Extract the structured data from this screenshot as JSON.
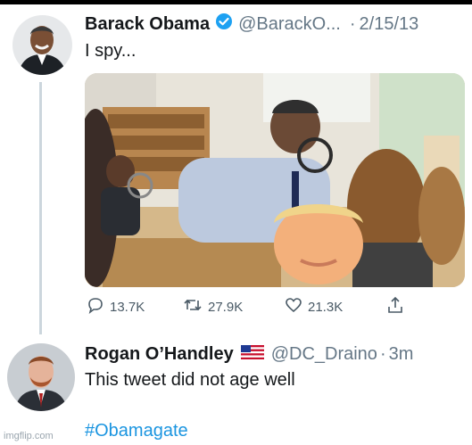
{
  "tweet1": {
    "author_name": "Barack Obama",
    "handle": "@BarackO...",
    "separator": "·",
    "date": "2/15/13",
    "text": "I spy...",
    "actions": {
      "replies": "13.7K",
      "retweets": "27.9K",
      "likes": "21.3K"
    }
  },
  "tweet2": {
    "author_name": "Rogan O’Handley",
    "flag_icon": "us-flag-icon",
    "handle": "@DC_Draino",
    "separator": "·",
    "time": "3m",
    "text": "This tweet did not age well",
    "hashtag": "#Obamagate"
  },
  "watermark": "imgflip.com",
  "colors": {
    "link": "#1b95e0",
    "verified": "#1da1f2",
    "muted": "#657786"
  }
}
